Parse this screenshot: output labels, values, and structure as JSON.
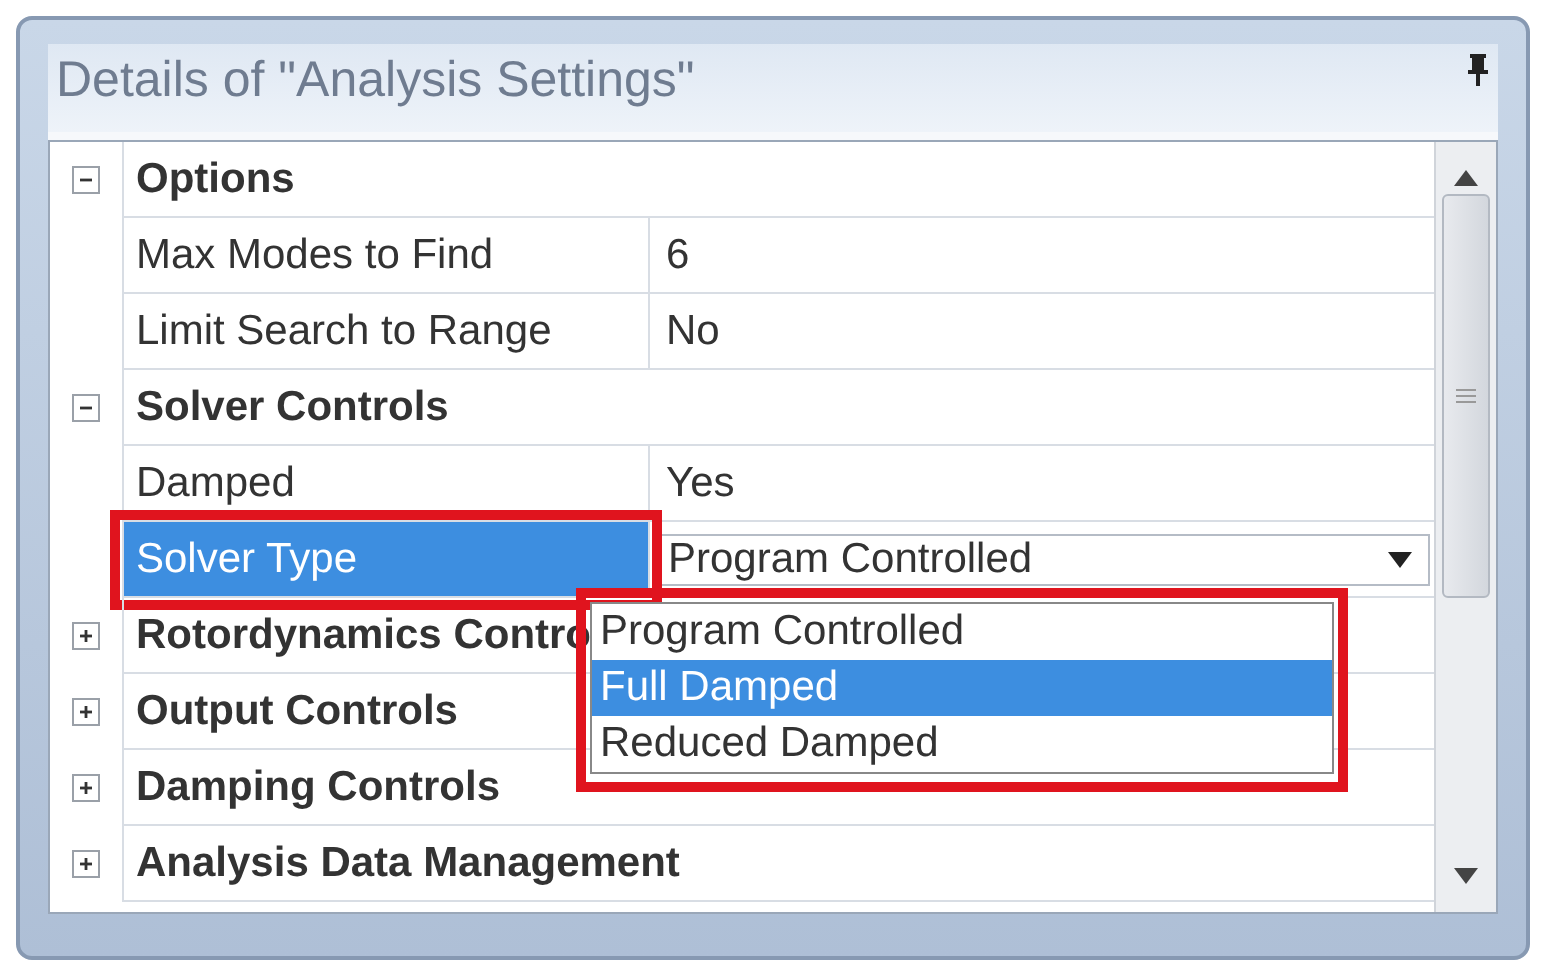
{
  "window": {
    "title": "Details of \"Analysis Settings\""
  },
  "groups": [
    {
      "label": "Options",
      "expanded": true,
      "children": [
        {
          "label": "Max Modes to Find",
          "value": "6",
          "selected": false,
          "highlighted": false
        },
        {
          "label": "Limit Search to Range",
          "value": "No",
          "selected": false,
          "highlighted": false
        }
      ]
    },
    {
      "label": "Solver Controls",
      "expanded": true,
      "children": [
        {
          "label": "Damped",
          "value": "Yes",
          "selected": false,
          "highlighted": false
        },
        {
          "label": "Solver Type",
          "value": "Program Controlled",
          "selected": true,
          "highlighted": true,
          "dropdown": {
            "open": true,
            "highlighted": true,
            "options": [
              {
                "label": "Program Controlled",
                "selected": false
              },
              {
                "label": "Full Damped",
                "selected": true
              },
              {
                "label": "Reduced Damped",
                "selected": false
              }
            ]
          }
        }
      ]
    },
    {
      "label": "Rotordynamics Contro",
      "expanded": false
    },
    {
      "label": "Output Controls",
      "expanded": false
    },
    {
      "label": "Damping Controls",
      "expanded": false
    },
    {
      "label": "Analysis Data Management",
      "expanded": false
    }
  ]
}
